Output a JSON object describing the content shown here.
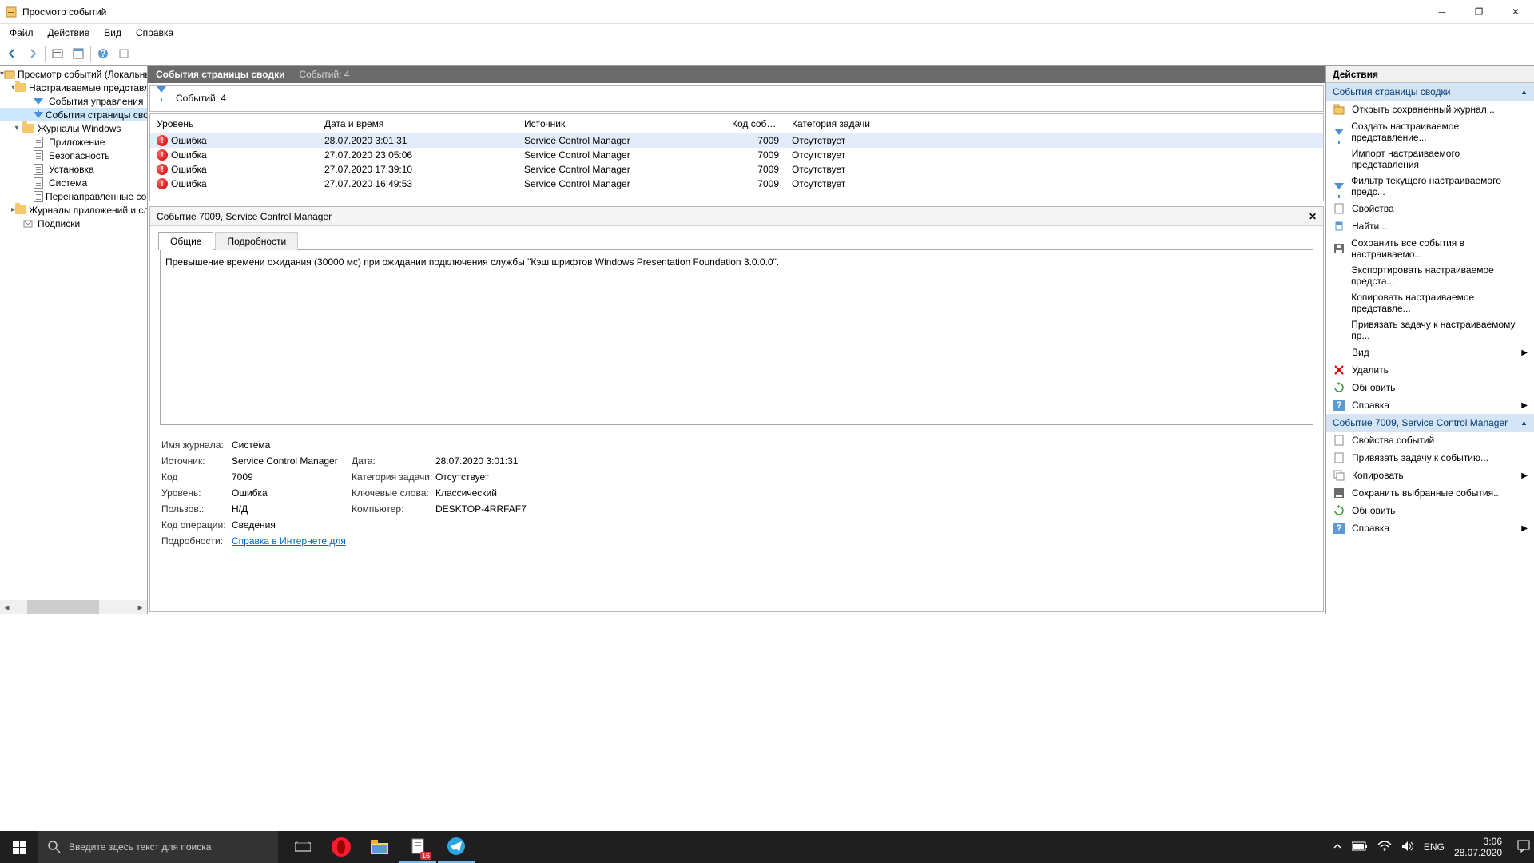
{
  "window": {
    "title": "Просмотр событий"
  },
  "menu": {
    "file": "Файл",
    "action": "Действие",
    "view": "Вид",
    "help": "Справка"
  },
  "tree": {
    "root": "Просмотр событий (Локальный)",
    "custom_views": "Настраиваемые представления",
    "admin_events": "События управления",
    "summary_events": "События страницы сводки",
    "win_logs": "Журналы Windows",
    "app": "Приложение",
    "security": "Безопасность",
    "setup": "Установка",
    "system": "Система",
    "forwarded": "Перенаправленные события",
    "app_svc_logs": "Журналы приложений и служб",
    "subscriptions": "Подписки"
  },
  "center": {
    "header_title": "События страницы сводки",
    "header_count": "Событий: 4",
    "filter_count": "Событий: 4",
    "cols": {
      "level": "Уровень",
      "date": "Дата и время",
      "source": "Источник",
      "id": "Код события",
      "cat": "Категория задачи"
    },
    "rows": [
      {
        "level": "Ошибка",
        "date": "28.07.2020 3:01:31",
        "source": "Service Control Manager",
        "id": "7009",
        "cat": "Отсутствует"
      },
      {
        "level": "Ошибка",
        "date": "27.07.2020 23:05:06",
        "source": "Service Control Manager",
        "id": "7009",
        "cat": "Отсутствует"
      },
      {
        "level": "Ошибка",
        "date": "27.07.2020 17:39:10",
        "source": "Service Control Manager",
        "id": "7009",
        "cat": "Отсутствует"
      },
      {
        "level": "Ошибка",
        "date": "27.07.2020 16:49:53",
        "source": "Service Control Manager",
        "id": "7009",
        "cat": "Отсутствует"
      }
    ]
  },
  "detail": {
    "title": "Событие 7009, Service Control Manager",
    "tab_general": "Общие",
    "tab_details": "Подробности",
    "message": "Превышение времени ожидания (30000 мс) при ожидании подключения службы \"Кэш шрифтов Windows Presentation Foundation 3.0.0.0\".",
    "labels": {
      "log": "Имя журнала:",
      "source": "Источник:",
      "code": "Код",
      "level": "Уровень:",
      "user": "Пользов.:",
      "opcode": "Код операции:",
      "more": "Подробности:",
      "date": "Дата:",
      "cat": "Категория задачи:",
      "keywords": "Ключевые слова:",
      "computer": "Компьютер:"
    },
    "values": {
      "log": "Система",
      "source": "Service Control Manager",
      "code": "7009",
      "level": "Ошибка",
      "user": "Н/Д",
      "opcode": "Сведения",
      "date": "28.07.2020 3:01:31",
      "cat": "Отсутствует",
      "keywords": "Классический",
      "computer": "DESKTOP-4RRFAF7",
      "more_link": "Справка в Интернете для "
    }
  },
  "actions": {
    "title": "Действия",
    "section1": "События страницы сводки",
    "items1": [
      "Открыть сохраненный журнал...",
      "Создать настраиваемое представление...",
      "Импорт настраиваемого представления",
      "Фильтр текущего настраиваемого предс...",
      "Свойства",
      "Найти...",
      "Сохранить все события в настраиваемо...",
      "Экспортировать настраиваемое предста...",
      "Копировать настраиваемое представле...",
      "Привязать задачу к настраиваемому пр..."
    ],
    "view": "Вид",
    "delete": "Удалить",
    "refresh": "Обновить",
    "help": "Справка",
    "section2": "Событие 7009, Service Control Manager",
    "items2": [
      "Свойства событий",
      "Привязать задачу к событию...",
      "Копировать",
      "Сохранить выбранные события...",
      "Обновить",
      "Справка"
    ]
  },
  "taskbar": {
    "search": "Введите здесь текст для поиска",
    "lang": "ENG",
    "time": "3:06",
    "date": "28.07.2020",
    "badge": "16"
  }
}
